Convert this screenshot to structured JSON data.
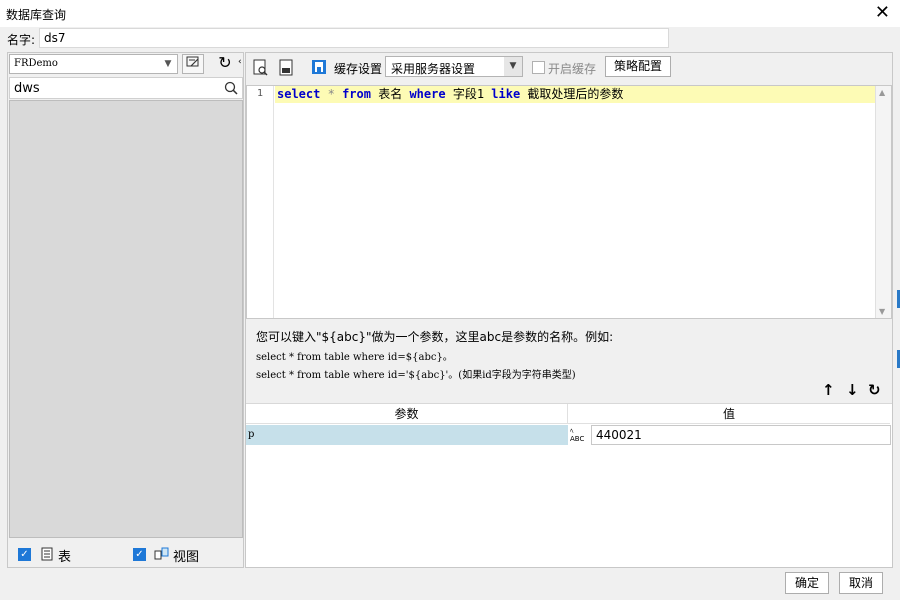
{
  "window": {
    "title": "数据库查询"
  },
  "name_row": {
    "label": "名字:",
    "value": "ds7"
  },
  "left_panel": {
    "connection": "FRDemo",
    "search_value": "dws",
    "options": [
      {
        "label": "表",
        "checked": true
      },
      {
        "label": "视图",
        "checked": true
      }
    ]
  },
  "toolbar": {
    "cache_label": "缓存设置",
    "cache_option": "采用服务器设置",
    "enable_cache_label": "开启缓存",
    "strategy_button": "策略配置"
  },
  "editor": {
    "line_number": "1",
    "tokens": {
      "select": "select",
      "star": "*",
      "from": "from",
      "table": "表名",
      "where": "where",
      "field": "字段1",
      "like": "like",
      "rest": "截取处理后的参数"
    }
  },
  "hint": {
    "line1": "您可以键入\"${abc}\"做为一个参数，这里abc是参数的名称。例如:",
    "line2": "select * from table where id=${abc}。",
    "line3": "select * from table where id='${abc}'。(如果id字段为字符串类型)"
  },
  "params": {
    "col_name": "参数",
    "col_value": "值",
    "rows": [
      {
        "name": "p",
        "type_icon": "ABC",
        "value": "440021"
      }
    ]
  },
  "footer": {
    "ok": "确定",
    "cancel": "取消"
  }
}
